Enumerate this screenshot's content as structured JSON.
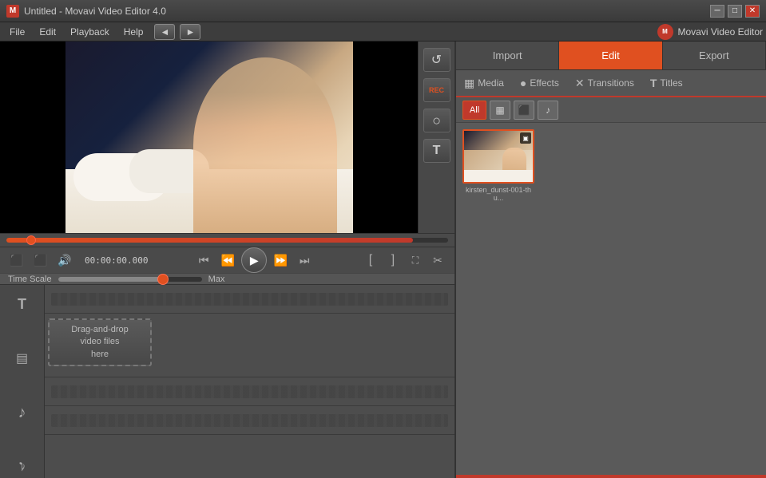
{
  "titleBar": {
    "title": "Untitled - Movavi Video Editor 4.0",
    "appIconLabel": "M",
    "buttons": {
      "minimize": "─",
      "maximize": "□",
      "close": "✕"
    }
  },
  "menuBar": {
    "items": [
      "File",
      "Edit",
      "Playback",
      "Help"
    ],
    "navBack": "◄",
    "navForward": "►",
    "brand": "Movavi Video Editor"
  },
  "videoPlayer": {
    "sideControls": [
      "↺",
      "REC",
      "○",
      "T"
    ]
  },
  "progressBar": {
    "fillPercent": 92
  },
  "controls": {
    "timeDisplay": "00:00:00.000",
    "leftButtons": [
      "⬛",
      "⬛",
      "🔊"
    ],
    "playbackButtons": {
      "prev": "⏮",
      "back": "⏪",
      "play": "▶",
      "forward": "⏩",
      "next": "⏭"
    },
    "rightButtons": [
      "[",
      "]",
      "⛶",
      "✂"
    ]
  },
  "timescale": {
    "label": "Time Scale",
    "maxLabel": "Max"
  },
  "timeline": {
    "trackIcons": [
      "T",
      "▤",
      "♪",
      "♪"
    ],
    "dropZone": {
      "line1": "Drag-and-drop",
      "line2": "video files",
      "line3": "here"
    }
  },
  "rightPanel": {
    "topTabs": [
      {
        "id": "import",
        "label": "Import",
        "active": false
      },
      {
        "id": "edit",
        "label": "Edit",
        "active": true
      },
      {
        "id": "export",
        "label": "Export",
        "active": false
      }
    ],
    "subTabs": [
      {
        "id": "media",
        "label": "Media",
        "icon": "▦"
      },
      {
        "id": "effects",
        "label": "Effects",
        "icon": "●"
      },
      {
        "id": "transitions",
        "label": "Transitions",
        "icon": "✕"
      },
      {
        "id": "titles",
        "label": "Titles",
        "icon": "T"
      }
    ],
    "filterButtons": [
      {
        "id": "all",
        "label": "All",
        "active": true
      },
      {
        "id": "video",
        "icon": "▦",
        "active": false
      },
      {
        "id": "image",
        "icon": "⬛",
        "active": false
      },
      {
        "id": "audio",
        "icon": "♪",
        "active": false
      }
    ],
    "mediaItems": [
      {
        "id": "item1",
        "label": "kirsten_dunst-001-thu...",
        "hasFilmIcon": true
      }
    ]
  }
}
